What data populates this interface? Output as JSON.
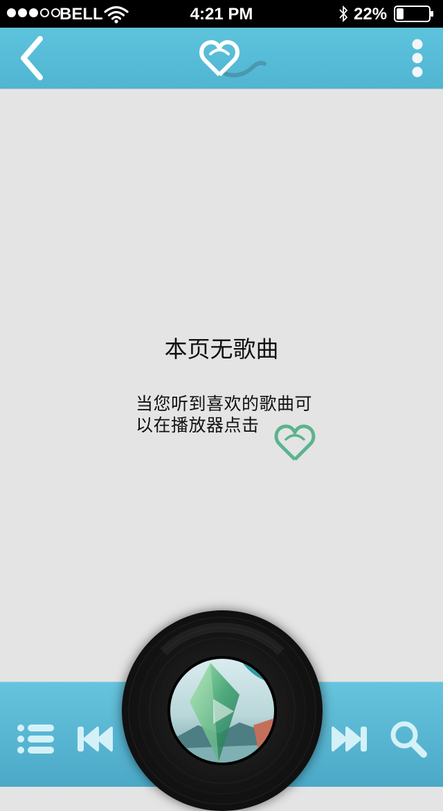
{
  "status_bar": {
    "signal_dots": [
      true,
      true,
      true,
      false,
      false
    ],
    "carrier": "BELL",
    "time": "4:21 PM",
    "battery": "22%",
    "battery_level": 0.22
  },
  "nav": {
    "back_icon": "chevron-left-icon",
    "logo_icon": "heart-logo-icon",
    "more_icon": "more-vertical-icon"
  },
  "empty_state": {
    "title": "本页无歌曲",
    "hint_line1": "当您听到喜欢的歌曲可",
    "hint_line2": "以在播放器点击",
    "heart_icon": "heart-icon"
  },
  "player": {
    "playlist_icon": "playlist-icon",
    "prev_icon": "previous-track-icon",
    "next_icon": "next-track-icon",
    "search_icon": "search-icon",
    "play_icon": "play-icon"
  },
  "colors": {
    "nav": "#56bcd8",
    "background": "#e4e4e4",
    "accent_heart": "#5bb48e",
    "control_icon": "#d4f1f8"
  }
}
